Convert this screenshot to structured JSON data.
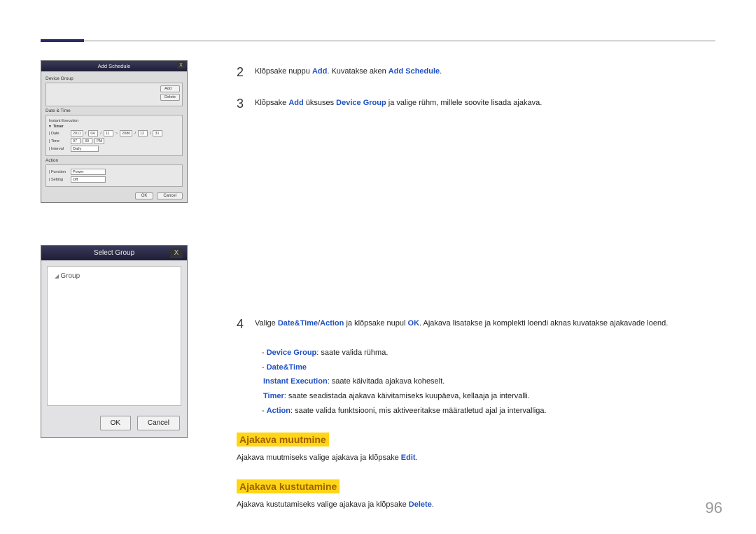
{
  "page_number": "96",
  "steps": {
    "s2": {
      "num": "2",
      "pre": "Klõpsake nuppu ",
      "b1": "Add",
      "mid": ". Kuvatakse aken ",
      "b2": "Add Schedule",
      "post": "."
    },
    "s3": {
      "num": "3",
      "pre": "Klõpsake ",
      "b1": "Add",
      "mid": " üksuses ",
      "b2": "Device Group",
      "post": " ja valige rühm, millele soovite lisada ajakava."
    },
    "s4": {
      "num": "4",
      "pre": "Valige ",
      "b1": "Date&Time",
      "slash1": "/",
      "b2": "Action",
      "mid": " ja klõpsake nupul ",
      "b3": "OK",
      "post": ". Ajakava lisatakse ja komplekti loendi aknas kuvatakse ajakavade loend."
    }
  },
  "sub": {
    "dg": {
      "label": "Device Group",
      "text": ": saate valida rühma."
    },
    "dt": {
      "label": "Date&Time"
    },
    "ie": {
      "label": "Instant Execution",
      "text": ": saate käivitada ajakava koheselt."
    },
    "tm": {
      "label": "Timer",
      "text": ": saate seadistada ajakava käivitamiseks kuupäeva, kellaaja ja intervalli."
    },
    "ac": {
      "label": "Action",
      "text": ": saate valida funktsiooni, mis aktiveeritakse määratletud ajal ja intervalliga."
    }
  },
  "sect1": {
    "title": "Ajakava muutmine",
    "pre": "Ajakava muutmiseks valige ajakava ja klõpsake ",
    "b1": "Edit",
    "post": "."
  },
  "sect2": {
    "title": "Ajakava kustutamine",
    "pre": "Ajakava kustutamiseks valige ajakava ja klõpsake ",
    "b1": "Delete",
    "post": "."
  },
  "dlg1": {
    "title": "Add Schedule",
    "close": "X",
    "device_group": "Device Group",
    "add": "Add",
    "delete": "Delete",
    "date_time": "Date & Time",
    "instant": "Instant Execution",
    "timer": "Timer",
    "date_lbl": "Date",
    "date_y1": "2011",
    "date_m1": "04",
    "date_d1": "11",
    "date_sep": "~",
    "date_y2": "2086",
    "date_m2": "12",
    "date_d2": "31",
    "time_lbl": "Time",
    "time_h": "07",
    "time_m": "30",
    "time_ap": "PM",
    "interval_lbl": "Interval",
    "interval_v": "Daily",
    "action": "Action",
    "func_lbl": "Function",
    "func_v": "Power",
    "set_lbl": "Setting",
    "set_v": "Off",
    "ok": "OK",
    "cancel": "Cancel"
  },
  "dlg2": {
    "title": "Select Group",
    "close": "X",
    "group": "Group",
    "ok": "OK",
    "cancel": "Cancel"
  }
}
